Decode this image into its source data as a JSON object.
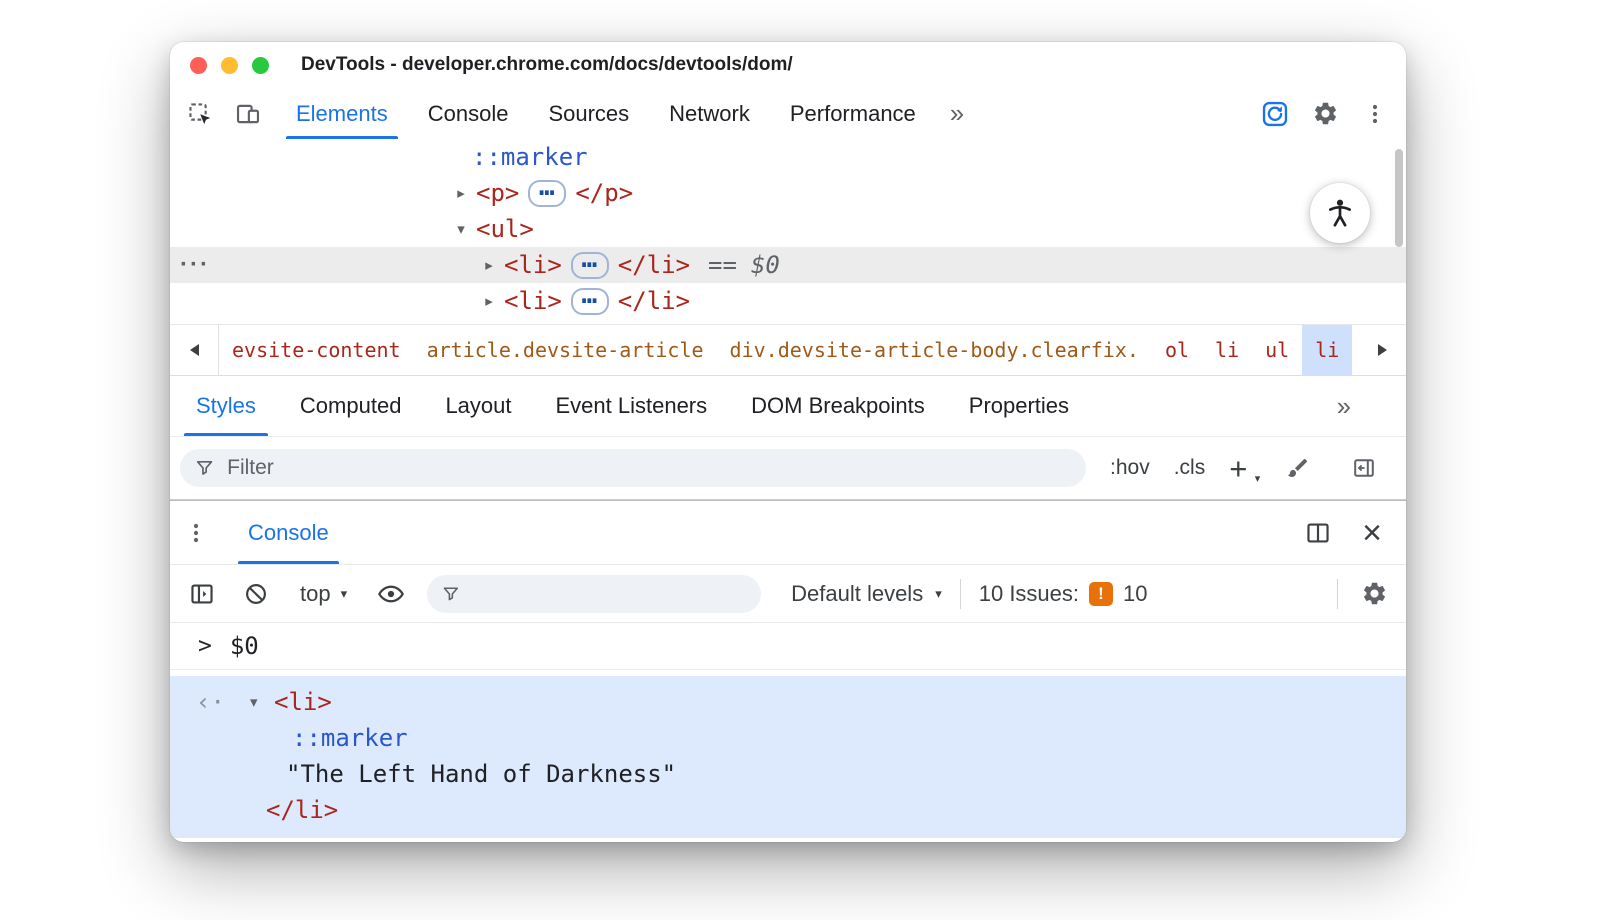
{
  "colors": {
    "accent_blue": "#1a73e8",
    "code_tag": "#a9261d",
    "code_class": "#a05a18",
    "code_pseudo": "#2b57c8",
    "muted_gray": "#5f6368",
    "text_dark": "#202124",
    "selected_row_bg": "#ececec",
    "result_bg": "#dde9fd",
    "issue_orange": "#e8710a",
    "traffic_red": "#ff5f57",
    "traffic_yellow": "#febc2e",
    "traffic_green": "#2ac840"
  },
  "icons": {
    "overflow_chevrons": "››",
    "caret_down": "▾",
    "close": "×",
    "issue_glyph": "!"
  },
  "titlebar": {
    "title": "DevTools - developer.chrome.com/docs/devtools/dom/"
  },
  "main_toolbar": {
    "tabs": [
      {
        "label": "Elements"
      },
      {
        "label": "Console"
      },
      {
        "label": "Sources"
      },
      {
        "label": "Network"
      },
      {
        "label": "Performance"
      }
    ]
  },
  "dom_tree": {
    "marker_row": {
      "pseudo": "::marker"
    },
    "p_row": {
      "arrow": "▸",
      "open": "<p>",
      "dots": "…",
      "close": "</p>"
    },
    "ul_row": {
      "arrow": "▾",
      "open": "<ul>"
    },
    "li_selected_row": {
      "left_dots": "···",
      "arrow": "▸",
      "open": "<li>",
      "dots": "…",
      "close": "</li>",
      "equals": "==",
      "ref": "$0"
    },
    "li_row": {
      "arrow": "▸",
      "open": "<li>",
      "dots": "…",
      "close": "</li>"
    }
  },
  "breadcrumbs": {
    "items": [
      {
        "label": "evsite-content"
      },
      {
        "label": "article.devsite-article"
      },
      {
        "label": "div.devsite-article-body.clearfix."
      },
      {
        "label": "ol"
      },
      {
        "label": "li"
      },
      {
        "label": "ul"
      },
      {
        "label": "li"
      }
    ]
  },
  "styles_panel": {
    "tabs": [
      {
        "label": "Styles"
      },
      {
        "label": "Computed"
      },
      {
        "label": "Layout"
      },
      {
        "label": "Event Listeners"
      },
      {
        "label": "DOM Breakpoints"
      },
      {
        "label": "Properties"
      }
    ],
    "filter_placeholder": "Filter",
    "hov_label": ":hov",
    "cls_label": ".cls",
    "new_rule_label": "+"
  },
  "console_drawer": {
    "tab_label": "Console",
    "context_label": "top",
    "filter_placeholder": "",
    "levels_label": "Default levels",
    "issues_label": "10 Issues:",
    "issues_count": "10",
    "prompt": {
      "chevron": ">",
      "expression": "$0"
    },
    "result": {
      "marker": "‹·",
      "caret": "▾",
      "li_open": "<li>",
      "pseudo": "::marker",
      "string": "\"The Left Hand of Darkness\"",
      "li_close": "</li>"
    }
  }
}
